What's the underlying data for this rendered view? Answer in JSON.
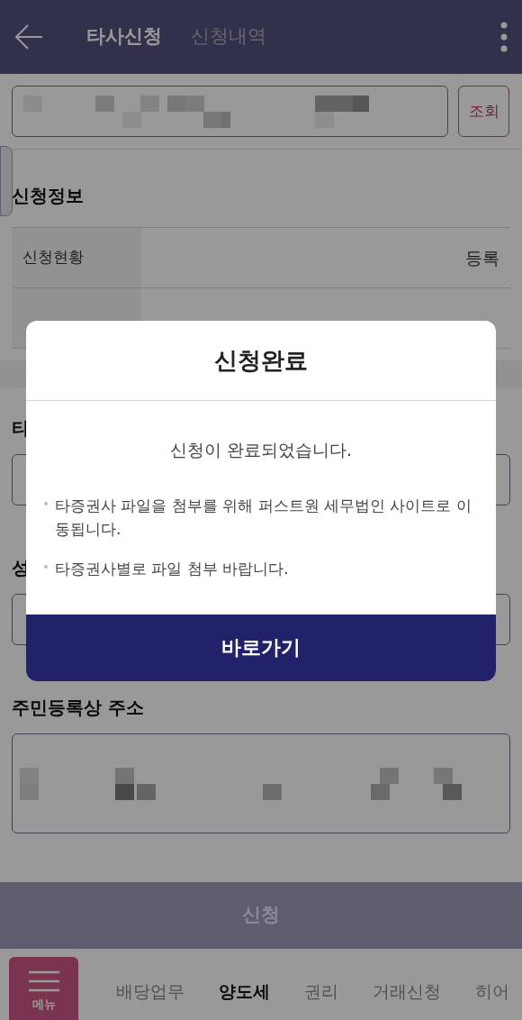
{
  "header": {
    "tabs": [
      {
        "label": "타사신청",
        "selected": true
      },
      {
        "label": "신청내역",
        "selected": false
      }
    ]
  },
  "search": {
    "button": "조회"
  },
  "info": {
    "title": "신청정보",
    "rows": [
      {
        "label": "신청현황",
        "value": "등록"
      },
      {}
    ]
  },
  "fields": [
    {
      "label": "타",
      "kind": "short"
    },
    {
      "label": "성",
      "kind": "short"
    },
    {
      "label": "주민등록상 주소",
      "kind": "tall"
    }
  ],
  "submit": {
    "label": "신청",
    "disabled": true
  },
  "nav": {
    "menu": "메뉴",
    "items": [
      {
        "label": "배당업무",
        "selected": false
      },
      {
        "label": "양도세",
        "selected": true
      },
      {
        "label": "권리",
        "selected": false
      },
      {
        "label": "거래신청",
        "selected": false
      },
      {
        "label": "히어",
        "selected": false
      }
    ]
  },
  "dialog": {
    "title": "신청완료",
    "message": "신청이 완료되었습니다.",
    "notes": [
      "타증권사 파일을 첨부를 위해 퍼스트원 세무법인 사이트로 이동됩니다.",
      "타증권사별로 파일 첨부 바랍니다."
    ],
    "button": "바로가기"
  }
}
